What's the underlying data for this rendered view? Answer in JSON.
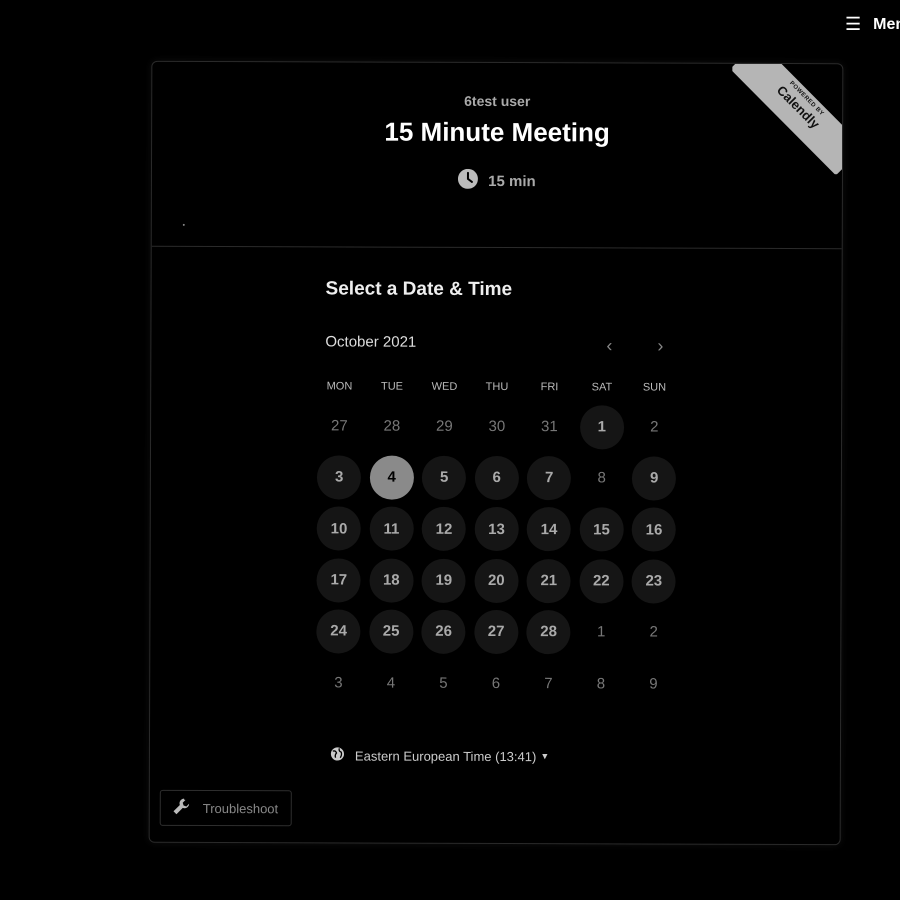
{
  "top_menu": {
    "label": "Menu",
    "icon": "hamburger-icon"
  },
  "badge": {
    "powered_by": "POWERED BY",
    "brand": "Calendly"
  },
  "event": {
    "host": "6test user",
    "title": "15 Minute Meeting",
    "duration": "15 min"
  },
  "calendar": {
    "section_title": "Select a Date & Time",
    "month_label": "October 2021",
    "weekdays": [
      "MON",
      "TUE",
      "WED",
      "THU",
      "FRI",
      "SAT",
      "SUN"
    ],
    "days": [
      {
        "label": "27",
        "state": "other"
      },
      {
        "label": "28",
        "state": "other"
      },
      {
        "label": "29",
        "state": "other"
      },
      {
        "label": "30",
        "state": "other"
      },
      {
        "label": "31",
        "state": "other"
      },
      {
        "label": "1",
        "state": "available"
      },
      {
        "label": "2",
        "state": "other"
      },
      {
        "label": "3",
        "state": "available"
      },
      {
        "label": "4",
        "state": "selected"
      },
      {
        "label": "5",
        "state": "available"
      },
      {
        "label": "6",
        "state": "available"
      },
      {
        "label": "7",
        "state": "available"
      },
      {
        "label": "8",
        "state": "unavailable"
      },
      {
        "label": "9",
        "state": "available"
      },
      {
        "label": "10",
        "state": "available"
      },
      {
        "label": "11",
        "state": "available"
      },
      {
        "label": "12",
        "state": "available"
      },
      {
        "label": "13",
        "state": "available"
      },
      {
        "label": "14",
        "state": "available"
      },
      {
        "label": "15",
        "state": "available"
      },
      {
        "label": "16",
        "state": "available"
      },
      {
        "label": "17",
        "state": "available"
      },
      {
        "label": "18",
        "state": "available"
      },
      {
        "label": "19",
        "state": "available"
      },
      {
        "label": "20",
        "state": "available"
      },
      {
        "label": "21",
        "state": "available"
      },
      {
        "label": "22",
        "state": "available"
      },
      {
        "label": "23",
        "state": "available"
      },
      {
        "label": "24",
        "state": "available"
      },
      {
        "label": "25",
        "state": "available"
      },
      {
        "label": "26",
        "state": "available"
      },
      {
        "label": "27",
        "state": "available"
      },
      {
        "label": "28",
        "state": "available"
      },
      {
        "label": "1",
        "state": "other"
      },
      {
        "label": "2",
        "state": "other"
      },
      {
        "label": "3",
        "state": "other"
      },
      {
        "label": "4",
        "state": "other"
      },
      {
        "label": "5",
        "state": "other"
      },
      {
        "label": "6",
        "state": "other"
      },
      {
        "label": "7",
        "state": "other"
      },
      {
        "label": "8",
        "state": "other"
      },
      {
        "label": "9",
        "state": "other"
      }
    ]
  },
  "timezone": {
    "label": "Eastern European Time (13:41)"
  },
  "troubleshoot": {
    "label": "Troubleshoot"
  }
}
